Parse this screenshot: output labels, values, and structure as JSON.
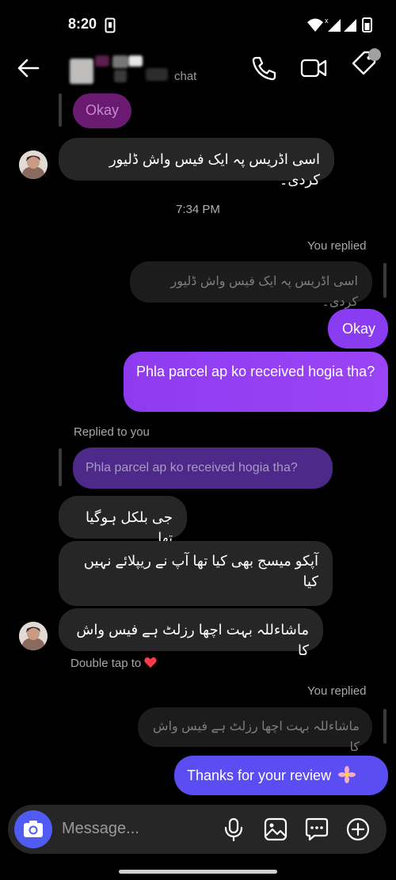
{
  "status_bar": {
    "time": "8:20"
  },
  "header": {
    "contact_suffix": "chat"
  },
  "messages": {
    "top_partial": "Okay",
    "incoming_1": "اسی اڈریس پہ ایک فیس واش ڈلیور کردی۔",
    "timestamp": "7:34 PM",
    "you_replied_1": "You replied",
    "quoted_1": "اسی اڈریس پہ ایک فیس واش ڈلیور کردی۔",
    "out_okay": "Okay",
    "out_parcel": "Phla parcel ap ko received hogia tha?",
    "replied_to_you": "Replied to you",
    "quoted_2": "Phla parcel ap ko received hogia tha?",
    "incoming_2": "جی بلکل ہوگیا تھا",
    "incoming_3": "آپکو میسج بھی کیا تھا آپ نے ریپلائے نہیں کیا",
    "incoming_4": "ماشاءللہ بہت اچھا رزلٹ ہے فیس واش کا",
    "double_tap": "Double tap to",
    "you_replied_2": "You replied",
    "quoted_3": "ماشاءللہ بہت اچھا رزلٹ ہے فیس واش کا",
    "out_thanks": "Thanks for your review"
  },
  "composer": {
    "placeholder": "Message..."
  },
  "colors": {
    "accent_purple": "#9b44f5",
    "accent_blue": "#5a4df2",
    "incoming_bubble": "#262626",
    "heart": "#ff3b4a"
  },
  "icons": [
    "back-arrow-icon",
    "phone-icon",
    "video-camera-icon",
    "tag-icon",
    "camera-icon",
    "microphone-icon",
    "gallery-icon",
    "sticker-icon",
    "plus-circle-icon",
    "heart-icon",
    "flower-emoji-icon"
  ]
}
